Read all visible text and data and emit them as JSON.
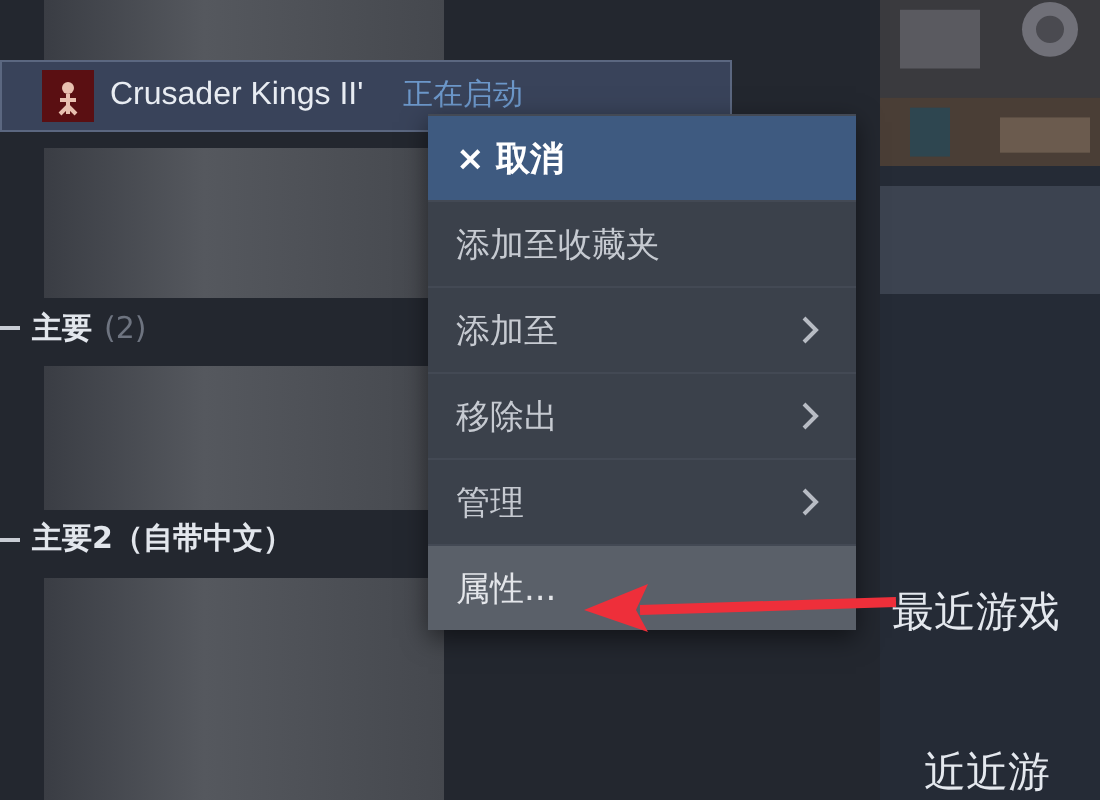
{
  "library": {
    "game_row": {
      "title": "Crusader Kings II'",
      "status": "正在启动",
      "selected": true
    },
    "sections": [
      {
        "name": "主要",
        "count": "(2)"
      },
      {
        "name": "主要2（自带中文）"
      }
    ]
  },
  "context_menu": {
    "items": [
      {
        "label": "× 取消",
        "selected": true,
        "hovered": false,
        "submenu": false
      },
      {
        "label": "添加至收藏夹",
        "selected": false,
        "hovered": false,
        "submenu": false
      },
      {
        "label": "添加至",
        "selected": false,
        "hovered": false,
        "submenu": true
      },
      {
        "label": "移除出",
        "selected": false,
        "hovered": false,
        "submenu": true
      },
      {
        "label": "管理",
        "selected": false,
        "hovered": false,
        "submenu": true
      },
      {
        "label": "属性...",
        "selected": false,
        "hovered": true,
        "submenu": false
      }
    ]
  },
  "recent": {
    "heading": "最近游戏",
    "heading_repeat": "近近游"
  }
}
